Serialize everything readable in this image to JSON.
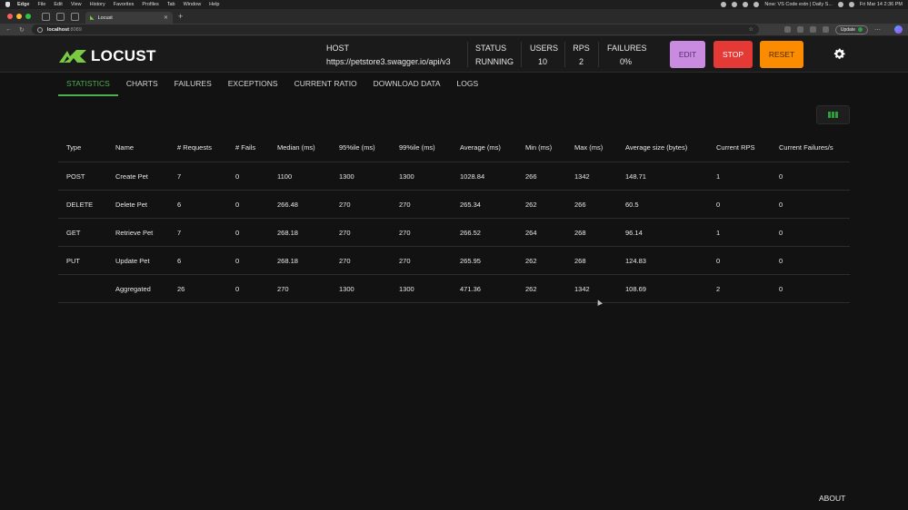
{
  "menubar": {
    "items": [
      "Edge",
      "File",
      "Edit",
      "View",
      "History",
      "Favorites",
      "Profiles",
      "Tab",
      "Window",
      "Help"
    ],
    "status_text": "Now: VS Code extn | Daily S...",
    "clock": "Fri Mar 14  2:36 PM"
  },
  "browser": {
    "tab_title": "Locust",
    "url_host": "localhost",
    "url_port": ":8089",
    "update_label": "Update"
  },
  "header": {
    "logo_text": "LOCUST",
    "host_label": "HOST",
    "host_value": "https://petstore3.swagger.io/api/v3",
    "status_label": "STATUS",
    "status_value": "RUNNING",
    "users_label": "USERS",
    "users_value": "10",
    "rps_label": "RPS",
    "rps_value": "2",
    "failures_label": "FAILURES",
    "failures_value": "0%",
    "edit_label": "EDIT",
    "stop_label": "STOP",
    "reset_label": "RESET"
  },
  "tabs": [
    "STATISTICS",
    "CHARTS",
    "FAILURES",
    "EXCEPTIONS",
    "CURRENT RATIO",
    "DOWNLOAD DATA",
    "LOGS"
  ],
  "table": {
    "columns": [
      "Type",
      "Name",
      "# Requests",
      "# Fails",
      "Median (ms)",
      "95%ile (ms)",
      "99%ile (ms)",
      "Average (ms)",
      "Min (ms)",
      "Max (ms)",
      "Average size (bytes)",
      "Current RPS",
      "Current Failures/s"
    ],
    "rows": [
      [
        "POST",
        "Create Pet",
        "7",
        "0",
        "1100",
        "1300",
        "1300",
        "1028.84",
        "266",
        "1342",
        "148.71",
        "1",
        "0"
      ],
      [
        "DELETE",
        "Delete Pet",
        "6",
        "0",
        "266.48",
        "270",
        "270",
        "265.34",
        "262",
        "266",
        "60.5",
        "0",
        "0"
      ],
      [
        "GET",
        "Retrieve Pet",
        "7",
        "0",
        "268.18",
        "270",
        "270",
        "266.52",
        "264",
        "268",
        "96.14",
        "1",
        "0"
      ],
      [
        "PUT",
        "Update Pet",
        "6",
        "0",
        "268.18",
        "270",
        "270",
        "265.95",
        "262",
        "268",
        "124.83",
        "0",
        "0"
      ],
      [
        "",
        "Aggregated",
        "26",
        "0",
        "270",
        "1300",
        "1300",
        "471.36",
        "262",
        "1342",
        "108.69",
        "2",
        "0"
      ]
    ]
  },
  "footer": {
    "about_label": "ABOUT"
  },
  "colors": {
    "accent": "#4caf50",
    "edit": "#c98be0",
    "stop": "#e53935",
    "reset": "#fb8c00"
  }
}
